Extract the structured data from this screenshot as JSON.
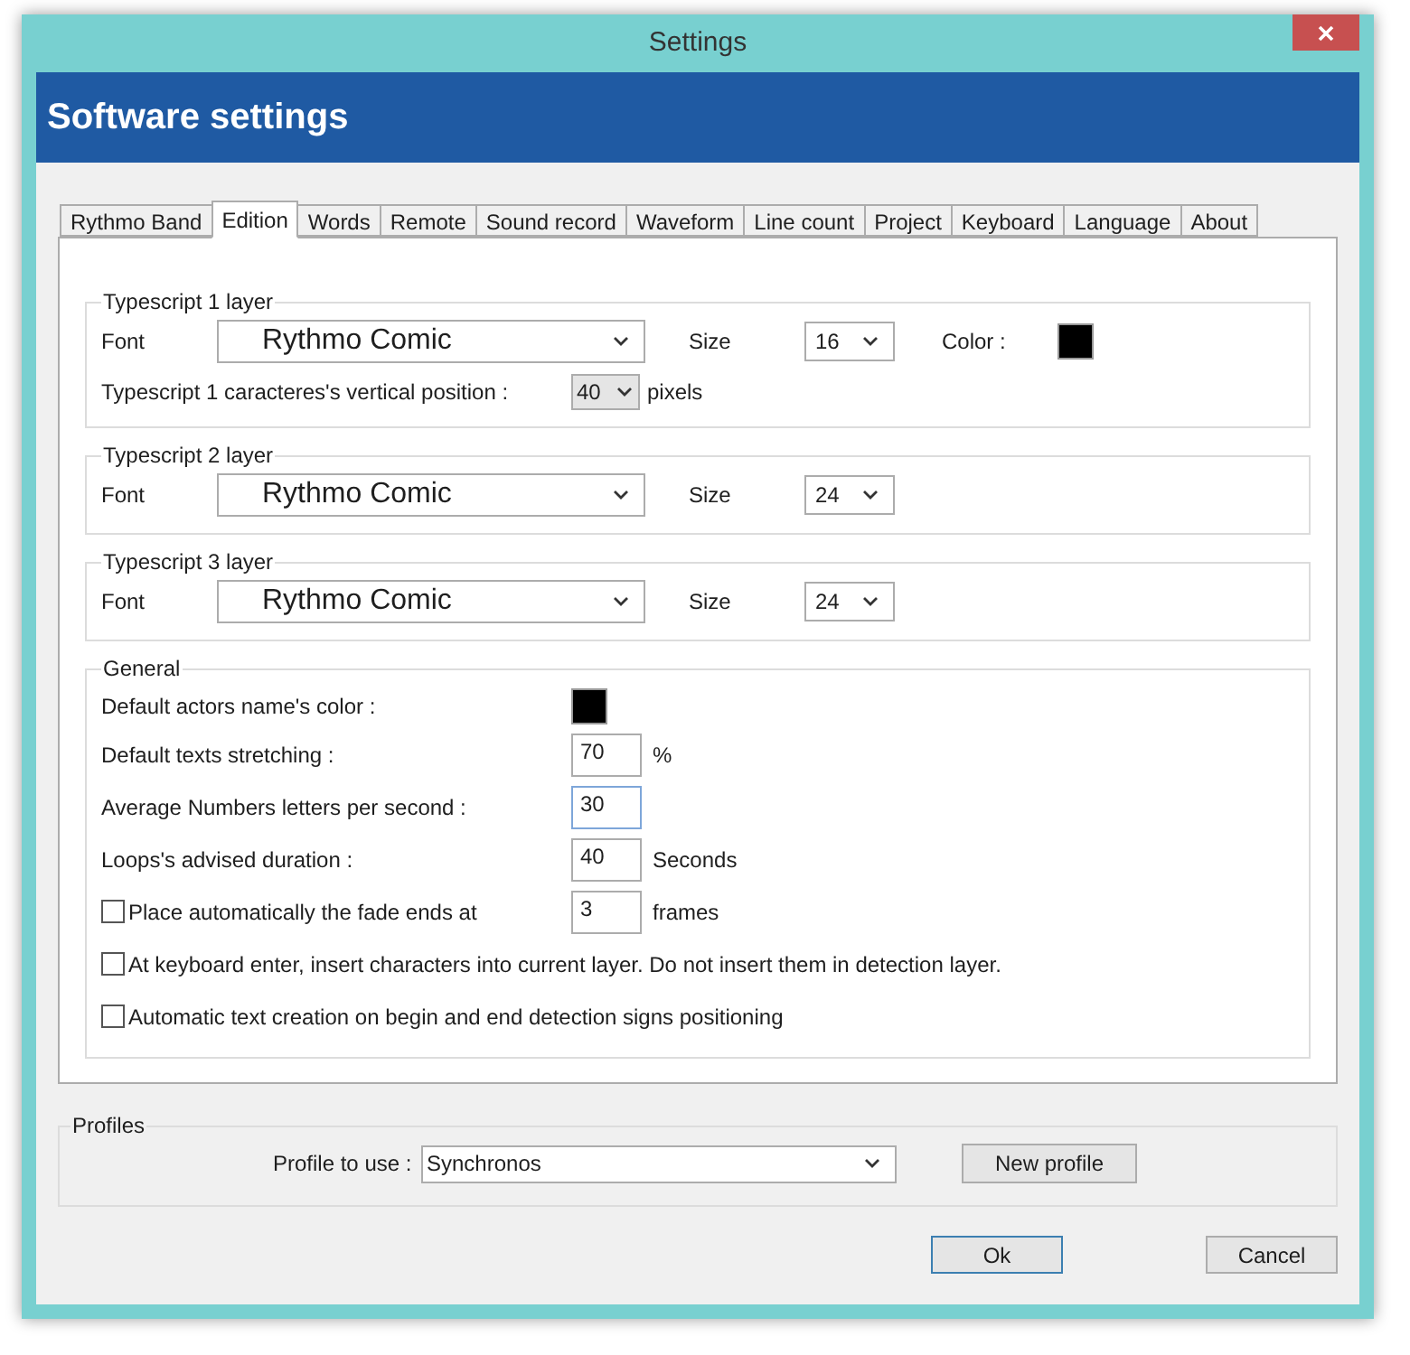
{
  "window": {
    "title": "Settings"
  },
  "header": {
    "title": "Software settings"
  },
  "tabs": [
    {
      "label": "Rythmo Band",
      "selected": false
    },
    {
      "label": "Edition",
      "selected": true
    },
    {
      "label": "Words",
      "selected": false
    },
    {
      "label": "Remote",
      "selected": false
    },
    {
      "label": "Sound record",
      "selected": false
    },
    {
      "label": "Waveform",
      "selected": false
    },
    {
      "label": "Line count",
      "selected": false
    },
    {
      "label": "Project",
      "selected": false
    },
    {
      "label": "Keyboard",
      "selected": false
    },
    {
      "label": "Language",
      "selected": false
    },
    {
      "label": "About",
      "selected": false
    }
  ],
  "layers": [
    {
      "legend": "Typescript 1 layer",
      "font_label": "Font",
      "font_value": "Rythmo Comic",
      "size_label": "Size",
      "size_value": "16",
      "color_label": "Color :",
      "color": "#000000",
      "position_label": "Typescript 1 caracteres's vertical position :",
      "position_value": "40",
      "position_unit": "pixels"
    },
    {
      "legend": "Typescript 2 layer",
      "font_label": "Font",
      "font_value": "Rythmo Comic",
      "size_label": "Size",
      "size_value": "24"
    },
    {
      "legend": "Typescript 3 layer",
      "font_label": "Font",
      "font_value": "Rythmo Comic",
      "size_label": "Size",
      "size_value": "24"
    }
  ],
  "general": {
    "legend": "General",
    "rows": [
      {
        "kind": "color",
        "label": "Default actors name's color :",
        "color": "#000000"
      },
      {
        "kind": "input",
        "label": "Default texts stretching :",
        "value": "70",
        "unit": "%",
        "focused": false
      },
      {
        "kind": "input",
        "label": "Average Numbers letters per second :",
        "value": "30",
        "focused": true
      },
      {
        "kind": "input",
        "label": "Loops's advised duration :",
        "value": "40",
        "unit": "Seconds",
        "focused": false
      },
      {
        "kind": "checkbox-input",
        "label": "Place automatically the fade ends at",
        "checked": false,
        "value": "3",
        "unit": "frames",
        "focused": false
      },
      {
        "kind": "checkbox",
        "label": "At keyboard enter, insert characters into current layer. Do not insert them in detection layer.",
        "checked": false
      },
      {
        "kind": "checkbox",
        "label": "Automatic text creation on begin and end detection signs positioning",
        "checked": false
      }
    ]
  },
  "profiles": {
    "legend": "Profiles",
    "label": "Profile to use :",
    "value": "Synchronos",
    "new_button": "New profile"
  },
  "buttons": [
    {
      "label": "Ok",
      "default": true
    },
    {
      "label": "Cancel",
      "default": false
    }
  ]
}
